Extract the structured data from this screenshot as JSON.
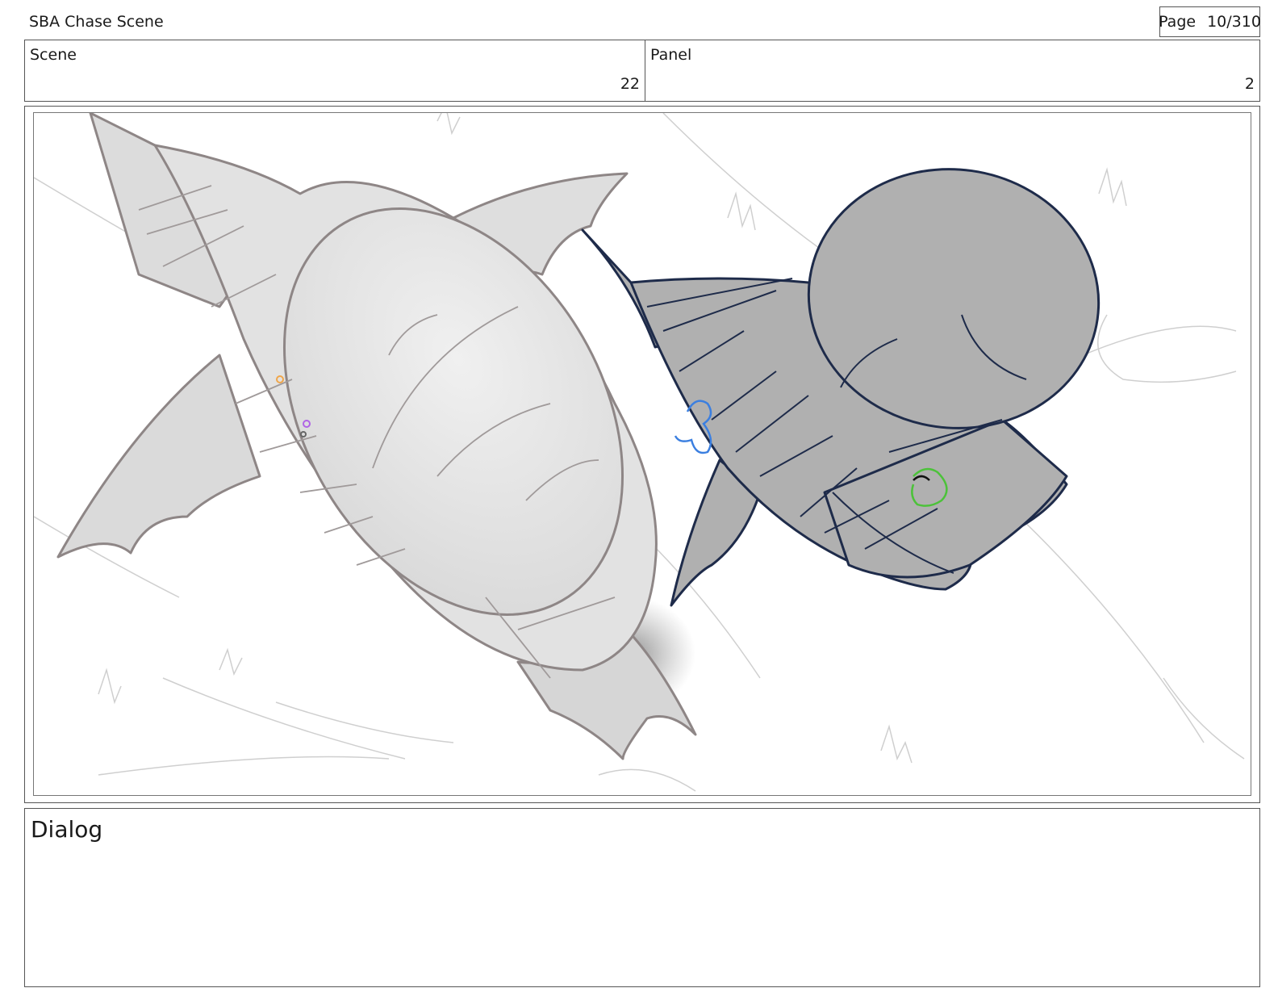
{
  "header": {
    "title": "SBA Chase Scene",
    "page_label": "Page",
    "page_value": "10/310"
  },
  "info": {
    "scene_label": "Scene",
    "scene_value": "22",
    "panel_label": "Panel",
    "panel_value": "2"
  },
  "dialog": {
    "label": "Dialog"
  },
  "colors": {
    "border": "#555555",
    "ship_light_fill": "#e4e4e4",
    "ship_light_stroke": "#8e8686",
    "ship_dark_fill": "#b0b0b0",
    "ship_dark_stroke": "#1e2b4a",
    "character_blue": "#3b7fe0",
    "character_green": "#4cc23a"
  }
}
